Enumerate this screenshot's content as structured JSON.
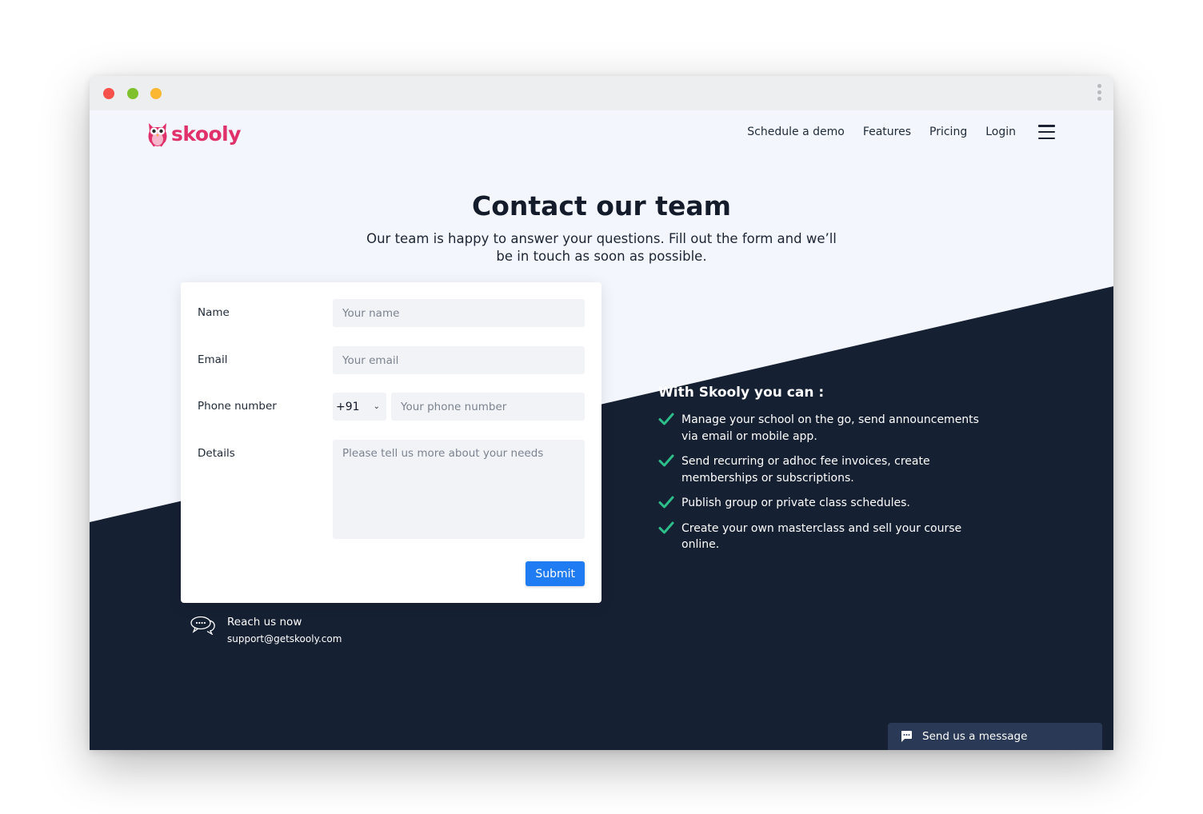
{
  "brand": {
    "name": "skooly",
    "color": "#e0316a"
  },
  "nav": {
    "items": [
      "Schedule a demo",
      "Features",
      "Pricing",
      "Login"
    ],
    "menu_icon": "hamburger-icon"
  },
  "hero": {
    "title": "Contact our team",
    "subtitle": "Our team is happy to answer your questions. Fill out the form and we’ll be in touch as soon as possible."
  },
  "form": {
    "name": {
      "label": "Name",
      "placeholder": "Your name",
      "value": ""
    },
    "email": {
      "label": "Email",
      "placeholder": "Your email",
      "value": ""
    },
    "phone": {
      "label": "Phone number",
      "country_code": "+91",
      "placeholder": "Your phone number",
      "value": ""
    },
    "details": {
      "label": "Details",
      "placeholder": "Please tell us more about your needs",
      "value": ""
    },
    "submit_label": "Submit"
  },
  "contact": {
    "title": "Reach us now",
    "email": "support@getskooly.com",
    "icon": "chat-bubbles-icon"
  },
  "features": {
    "title": "With Skooly you can :",
    "items": [
      "Manage your school on the go, send announcements via email or mobile app.",
      "Send recurring or adhoc fee invoices, create memberships or subscriptions.",
      "Publish group or private class schedules.",
      "Create your own masterclass and sell your course online."
    ],
    "check_color": "#2dbf8a"
  },
  "chat_widget": {
    "label": "Send us a message",
    "icon": "message-icon"
  },
  "colors": {
    "page_bg": "#f3f6fd",
    "dark_bg": "#162033",
    "accent": "#1f7cf3",
    "titlebar": "#eceeef"
  }
}
